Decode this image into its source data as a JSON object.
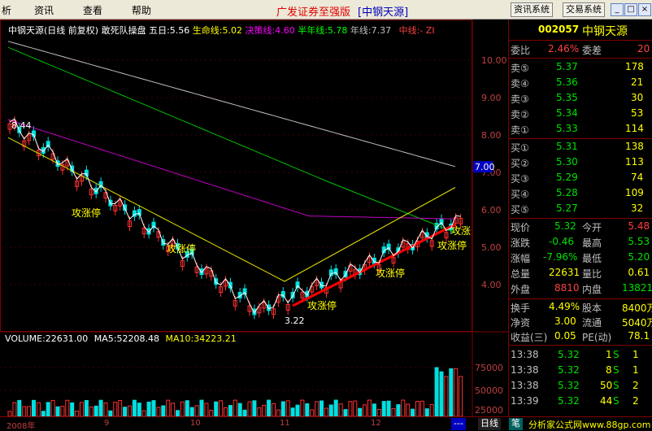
{
  "menubar": {
    "items": [
      "析",
      "资讯",
      "查看",
      "帮助"
    ],
    "title": "广发证券至强版",
    "stock_tag": "[中钢天源]",
    "btn_info": "资讯系统",
    "btn_trade": "交易系统",
    "win_min": "_",
    "win_max": "□",
    "win_close": "×"
  },
  "indicators": {
    "name": "中钢天源(日线 前复权)",
    "formula": "敢死队操盘",
    "ma5": "五日:5.56",
    "life": "生命线:5.02",
    "decision": "决策线:4.60",
    "half_year": "半年线:5.78",
    "year": "年线:7.37",
    "mid": "中线:-",
    "zi": "ZI"
  },
  "price_axis": [
    "10.00",
    "9.00",
    "8.00",
    "7.00",
    "6.00",
    "5.00",
    "4.00"
  ],
  "current_price_tag": "7.00",
  "annotations": {
    "high_mark": "8.44",
    "low_mark": "3.22",
    "limit_up": "攻涨停",
    "limit_up_short": "攻涨"
  },
  "volume_panel": {
    "volume": "VOLUME:22631.00",
    "ma5": "MA5:52208.48",
    "ma10": "MA10:34223.21",
    "axis": [
      "75000",
      "50000",
      "25000"
    ]
  },
  "time_axis": [
    "2008年",
    "9",
    "10",
    "11",
    "12"
  ],
  "quote": {
    "code": "002057",
    "name": "中钢天源",
    "weibi_label": "委比",
    "weibi_value": "2.46%",
    "weicha_label": "委差",
    "weicha_value": "20",
    "asks": [
      {
        "label": "卖⑤",
        "price": "5.37",
        "vol": "178"
      },
      {
        "label": "卖④",
        "price": "5.36",
        "vol": "21"
      },
      {
        "label": "卖③",
        "price": "5.35",
        "vol": "30"
      },
      {
        "label": "卖②",
        "price": "5.34",
        "vol": "53"
      },
      {
        "label": "卖①",
        "price": "5.33",
        "vol": "114"
      }
    ],
    "bids": [
      {
        "label": "买①",
        "price": "5.31",
        "vol": "138"
      },
      {
        "label": "买②",
        "price": "5.30",
        "vol": "113"
      },
      {
        "label": "买③",
        "price": "5.29",
        "vol": "74"
      },
      {
        "label": "买④",
        "price": "5.28",
        "vol": "109"
      },
      {
        "label": "买⑤",
        "price": "5.27",
        "vol": "32"
      }
    ],
    "stats": [
      {
        "l1": "现价",
        "v1": "5.32",
        "l2": "今开",
        "v2": "5.48"
      },
      {
        "l1": "涨跌",
        "v1": "-0.46",
        "l2": "最高",
        "v2": "5.53"
      },
      {
        "l1": "涨幅",
        "v1": "-7.96%",
        "l2": "最低",
        "v2": "5.20"
      },
      {
        "l1": "总量",
        "v1": "22631",
        "l2": "量比",
        "v2": "0.61"
      },
      {
        "l1": "外盘",
        "v1": "8810",
        "l2": "内盘",
        "v2": "13821"
      }
    ],
    "stats2": [
      {
        "l1": "换手",
        "v1": "4.49%",
        "l2": "股本",
        "v2": "8400万"
      },
      {
        "l1": "净资",
        "v1": "3.00",
        "l2": "流通",
        "v2": "5040万"
      },
      {
        "l1": "收益(三)",
        "v1": "0.05",
        "l2": "PE(动)",
        "v2": "78.1"
      }
    ],
    "ticks": [
      {
        "time": "13:38",
        "price": "5.32",
        "vol": "1",
        "side": "S",
        "n": "1"
      },
      {
        "time": "13:38",
        "price": "5.32",
        "vol": "8",
        "side": "S",
        "n": "1"
      },
      {
        "time": "13:38",
        "price": "5.32",
        "vol": "50",
        "side": "S",
        "n": "2"
      },
      {
        "time": "13:39",
        "price": "5.32",
        "vol": "44",
        "side": "S",
        "n": "2"
      }
    ]
  },
  "bottombar": {
    "tab_daily": "日线",
    "tab_pen": "笔",
    "site": "分析家公式网www.88gp.com",
    "dash": "---"
  }
}
